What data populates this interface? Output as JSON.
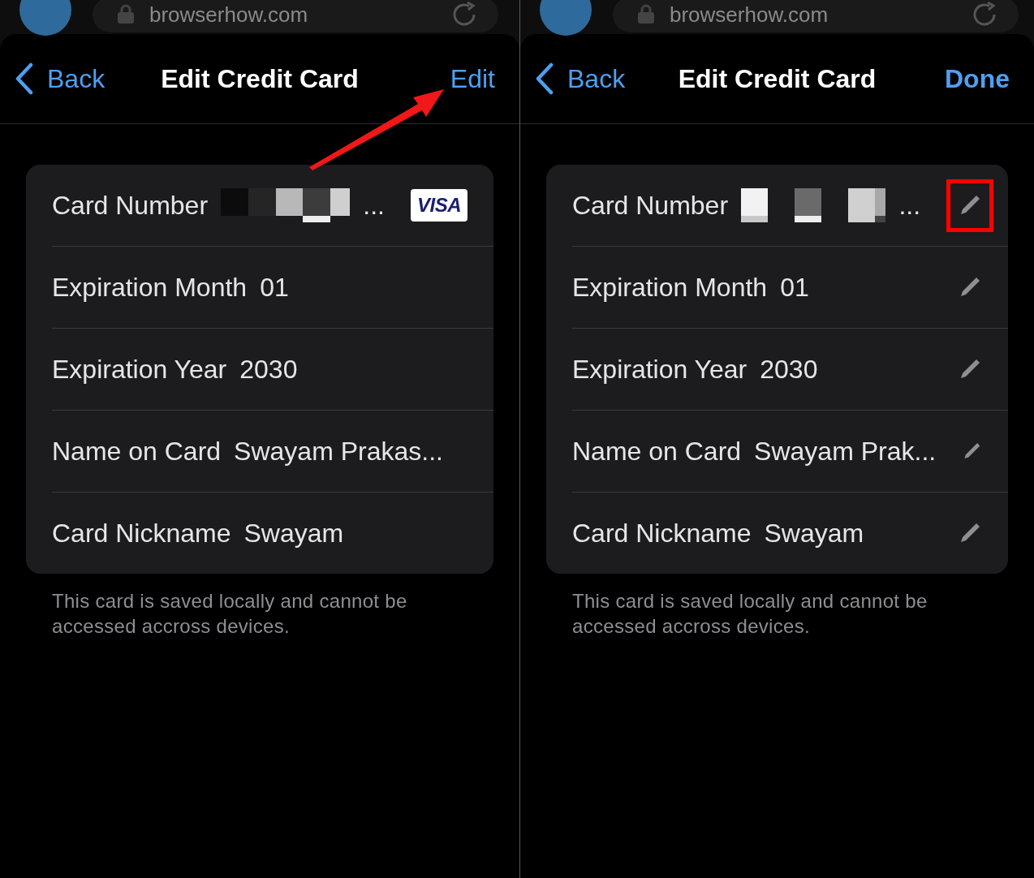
{
  "panels": [
    {
      "url": "browserhow.com",
      "back": "Back",
      "title": "Edit Credit Card",
      "action": "Edit",
      "arrow_to_action": true,
      "rows": [
        {
          "kind": "masked",
          "label": "Card Number",
          "value": "...",
          "badge": "VISA",
          "editable": false
        },
        {
          "kind": "text",
          "label": "Expiration Month",
          "value": "01",
          "editable": false
        },
        {
          "kind": "text",
          "label": "Expiration Year",
          "value": "2030",
          "editable": false
        },
        {
          "kind": "text",
          "label": "Name on Card",
          "value": "Swayam Prakas...",
          "editable": false
        },
        {
          "kind": "text",
          "label": "Card Nickname",
          "value": "Swayam",
          "editable": false
        }
      ],
      "footnote": "This card is saved locally and cannot be accessed accross devices."
    },
    {
      "url": "browserhow.com",
      "back": "Back",
      "title": "Edit Credit Card",
      "action": "Done",
      "rows": [
        {
          "kind": "masked",
          "label": "Card Number",
          "value": "...",
          "editable": true,
          "highlighted": true
        },
        {
          "kind": "text",
          "label": "Expiration Month",
          "value": "01",
          "editable": true
        },
        {
          "kind": "text",
          "label": "Expiration Year",
          "value": "2030",
          "editable": true
        },
        {
          "kind": "text",
          "label": "Name on Card",
          "value": "Swayam Prak...",
          "editable": true
        },
        {
          "kind": "text",
          "label": "Card Nickname",
          "value": "Swayam",
          "editable": true
        }
      ],
      "footnote": "This card is saved locally and cannot be accessed accross devices."
    }
  ]
}
